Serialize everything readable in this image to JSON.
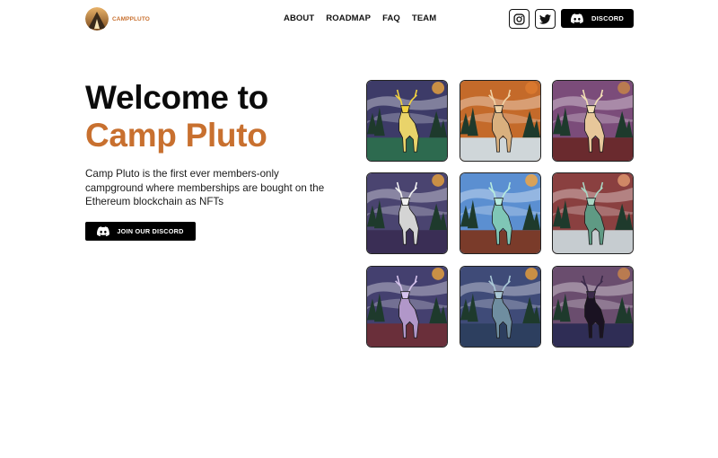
{
  "nav": {
    "brand": {
      "word1": "CAMP",
      "word2": "PLUTO",
      "logo_icon": "tent-mountain-logo"
    },
    "menu": [
      "ABOUT",
      "ROADMAP",
      "FAQ",
      "TEAM"
    ],
    "social": [
      {
        "icon": "instagram-icon"
      },
      {
        "icon": "twitter-icon"
      }
    ],
    "discord_button": {
      "label": "DISCORD",
      "icon": "discord-icon"
    }
  },
  "hero": {
    "title_line1": "Welcome to",
    "title_line2": "Camp Pluto",
    "description": "Camp Pluto is the first ever members-only campground where memberships are bought on the Ethereum blockchain as NFTs",
    "cta": {
      "label": "JOIN OUR DISCORD",
      "icon": "discord-icon"
    }
  },
  "colors": {
    "accent": "#c8702f",
    "text": "#0b0b0b",
    "button_bg": "#000000"
  },
  "gallery": [
    {
      "sky": "#3d3b68",
      "ground": "#2d6a4f",
      "deer": "#e9d36a",
      "accent": "#f2d23f",
      "moon": "#c98f45"
    },
    {
      "sky": "#c46a2a",
      "ground": "#cfd6d9",
      "deer": "#d9b07e",
      "accent": "#f0d2a5",
      "moon": "#d9782e"
    },
    {
      "sky": "#7b4c7a",
      "ground": "#6a2a2e",
      "deer": "#e7c79a",
      "accent": "#f3dfb5",
      "moon": "#b97b50"
    },
    {
      "sky": "#4a4470",
      "ground": "#3a2e55",
      "deer": "#d4d4d4",
      "accent": "#f2f2f2",
      "moon": "#c98f45"
    },
    {
      "sky": "#5b8fd1",
      "ground": "#7a3b2a",
      "deer": "#7fc6b6",
      "accent": "#b7ecdf",
      "moon": "#d9a25a"
    },
    {
      "sky": "#8a4040",
      "ground": "#c6ccd0",
      "deer": "#5f9a84",
      "accent": "#a9d6c3",
      "moon": "#d08866"
    },
    {
      "sky": "#44406f",
      "ground": "#6a2f3a",
      "deer": "#b197c9",
      "accent": "#d6c3ec",
      "moon": "#c98f45"
    },
    {
      "sky": "#3f4b78",
      "ground": "#2d3f5f",
      "deer": "#6f8ea0",
      "accent": "#a9c7d6",
      "moon": "#c98f45"
    },
    {
      "sky": "#6a4d6e",
      "ground": "#2f2d55",
      "deer": "#1a1222",
      "accent": "#3b2a4a",
      "moon": "#b97b50"
    }
  ]
}
